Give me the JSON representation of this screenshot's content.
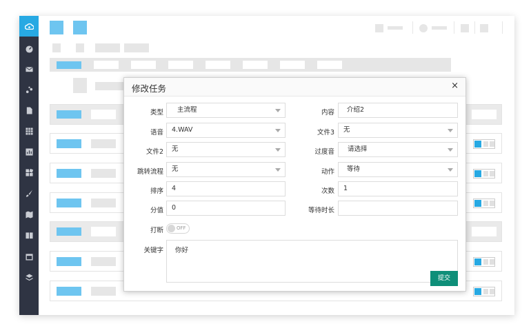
{
  "modal": {
    "title": "修改任务",
    "close": "×",
    "fields": {
      "type": {
        "label": "类型",
        "value": "主流程"
      },
      "content": {
        "label": "内容",
        "value": "介绍2"
      },
      "voice": {
        "label": "语音",
        "value": "4.WAV"
      },
      "file3": {
        "label": "文件3",
        "value": "无"
      },
      "file2": {
        "label": "文件2",
        "value": "无"
      },
      "transition": {
        "label": "过度音",
        "value": "请选择"
      },
      "jump": {
        "label": "跳转流程",
        "value": "无"
      },
      "action": {
        "label": "动作",
        "value": "等待"
      },
      "order": {
        "label": "排序",
        "value": "4"
      },
      "count": {
        "label": "次数",
        "value": "1"
      },
      "score": {
        "label": "分值",
        "value": "0"
      },
      "wait": {
        "label": "等待时长",
        "value": ""
      },
      "interrupt": {
        "label": "打断",
        "value": "OFF"
      },
      "keyword": {
        "label": "关键字",
        "value": "你好"
      }
    },
    "submit": "提交"
  },
  "icons": {
    "logo": "cloud-icon",
    "sidebar": [
      "dashboard-icon",
      "mail-icon",
      "share-icon",
      "file-icon",
      "grid-icon",
      "chart-icon",
      "puzzle-icon",
      "brush-icon",
      "map-icon",
      "book-icon",
      "calendar-icon",
      "layers-icon"
    ]
  },
  "colors": {
    "sidebar": "#2f3443",
    "accent": "#27a9e3",
    "placeholder_blue": "#6ec5f0",
    "submit": "#0e8f79"
  }
}
